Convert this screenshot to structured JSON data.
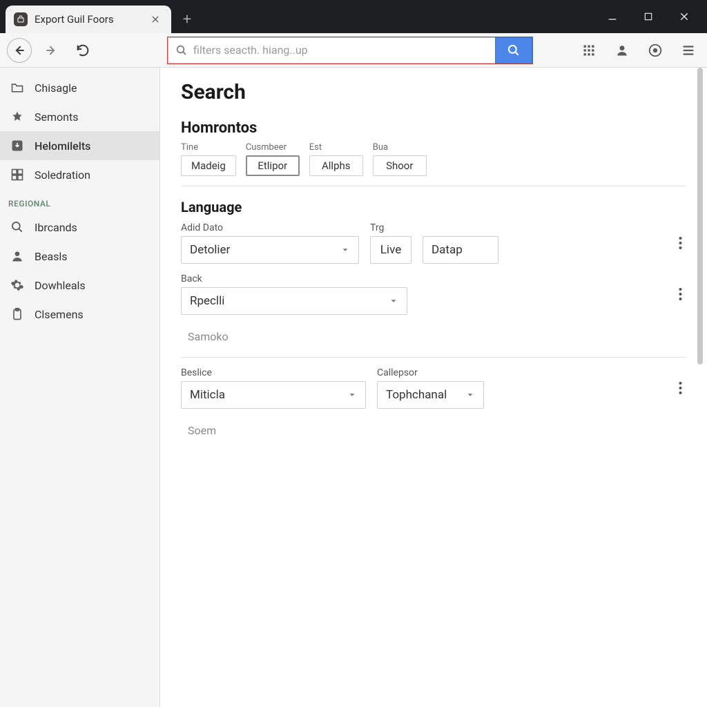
{
  "window": {
    "tab_title": "Export Guil Foors"
  },
  "toolbar": {
    "search_placeholder": "filters seacth. hiang..up"
  },
  "sidebar": {
    "items_top": [
      {
        "label": "Chisagle",
        "icon": "folder-icon"
      },
      {
        "label": "Semonts",
        "icon": "star-icon"
      },
      {
        "label": "Helomilelts",
        "icon": "download-box-icon",
        "active": true
      },
      {
        "label": "Soledration",
        "icon": "grid-icon"
      }
    ],
    "group_title": "REGIONAL",
    "items_bottom": [
      {
        "label": "Ibrcands",
        "icon": "search-icon"
      },
      {
        "label": "Beasls",
        "icon": "person-icon"
      },
      {
        "label": "Dowhleals",
        "icon": "gear-icon"
      },
      {
        "label": "Clsemens",
        "icon": "clipboard-icon"
      }
    ]
  },
  "main": {
    "page_title": "Search",
    "section1": {
      "title": "Homrontos",
      "pills": [
        {
          "label": "Tine",
          "button": "Madeig"
        },
        {
          "label": "Cusmbeer",
          "button": "Etlipor",
          "active": true
        },
        {
          "label": "Est",
          "button": "Allphs"
        },
        {
          "label": "Bua",
          "button": "Shoor"
        }
      ]
    },
    "section2": {
      "title": "Language",
      "row1": {
        "field1_label": "Adid Dato",
        "field1_value": "Detolier",
        "field2_label": "Trg",
        "field2_value": "Live",
        "field3_value": "Datap"
      },
      "row2": {
        "field1_label": "Back",
        "field1_value": "Rpeclli"
      },
      "ghost1": "Samoko",
      "row3": {
        "field1_label": "Beslice",
        "field1_value": "Miticla",
        "field2_label": "Callepsor",
        "field2_value": "Tophchanal"
      },
      "ghost2": "Soem"
    }
  }
}
